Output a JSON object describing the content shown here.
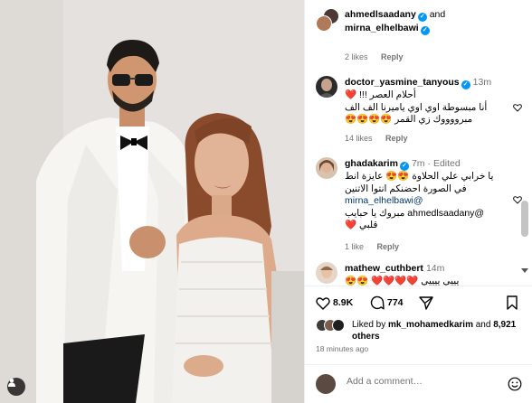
{
  "post": {
    "owner": "ahmedlsaadany",
    "connector": "and",
    "collaborator": "mirna_elhelbawi",
    "photo_alt": "Wedding photo"
  },
  "top_comment_meta": {
    "likes": "2 likes",
    "reply": "Reply"
  },
  "comments": [
    {
      "username": "doctor_yasmine_tanyous",
      "verified": true,
      "time": "13m",
      "lines": [
        "أحلام العصر !!! ❤️",
        "أنا مبسوطة اوي اوي ياميرنا الف الف",
        "مبرووووك زي القمر 😍😍😍😍"
      ],
      "likes": "14 likes",
      "reply": "Reply"
    },
    {
      "username": "ghadakarim",
      "verified": true,
      "time": "7m",
      "edited": "· Edited",
      "lines": [
        "يا خرابي علي الحلاوة 😍😍 عايزة انط",
        "في الصورة احضنكم انتوا الاتنين",
        "@mirna_elhelbawi",
        "@ahmedlsaadany مبروك يا حبايب",
        "قلبي ❤️"
      ],
      "likes": "1 like",
      "reply": "Reply"
    },
    {
      "username": "mathew_cuthbert",
      "verified": false,
      "time": "14m",
      "lines": [
        "يييي ييييي ❤️❤️❤️❤️ 😍😍"
      ]
    }
  ],
  "actions": {
    "likes_count": "8.9K",
    "comments_count": "774"
  },
  "liked_by": {
    "prefix": "Liked by",
    "user": "mk_mohamedkarim",
    "and": "and",
    "count": "8,921",
    "suffix": "others"
  },
  "time_ago": "18 minutes ago",
  "add_comment": {
    "placeholder": "Add a comment…"
  },
  "colors": {
    "accent": "#0095f6",
    "heart": "#ff3040",
    "muted": "#737373"
  }
}
